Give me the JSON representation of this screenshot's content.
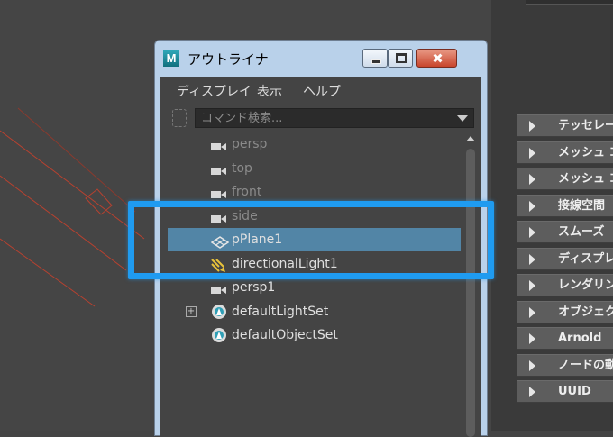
{
  "window": {
    "title": "アウトライナ",
    "app_icon_letter": "M"
  },
  "menu": [
    "ディスプレイ",
    "表示",
    "ヘルプ"
  ],
  "search": {
    "placeholder": "コマンド検索..."
  },
  "tree_items": [
    {
      "label": "persp",
      "icon": "camera-icon",
      "dim": true
    },
    {
      "label": "top",
      "icon": "camera-icon",
      "dim": true
    },
    {
      "label": "front",
      "icon": "camera-icon",
      "dim": true
    },
    {
      "label": "side",
      "icon": "camera-icon",
      "dim": true
    },
    {
      "label": "pPlane1",
      "icon": "mesh-icon",
      "selected": true
    },
    {
      "label": "directionalLight1",
      "icon": "directional-light-icon"
    },
    {
      "label": "persp1",
      "icon": "camera-icon"
    },
    {
      "label": "defaultLightSet",
      "icon": "set-icon",
      "expandable": true
    },
    {
      "label": "defaultObjectSet",
      "icon": "set-icon"
    }
  ],
  "attribute_sections": [
    "テッセレー",
    "メッシュ コ",
    "メッシュ コ",
    "接線空間",
    "スムーズ",
    "ディスプレ",
    "レンダリン",
    "オブジェク",
    "Arnold",
    "ノードの動",
    "UUID"
  ],
  "colors": {
    "highlight": "#1f9bf0",
    "selection": "#5285a6",
    "viewport_lines": "#b8412f"
  }
}
